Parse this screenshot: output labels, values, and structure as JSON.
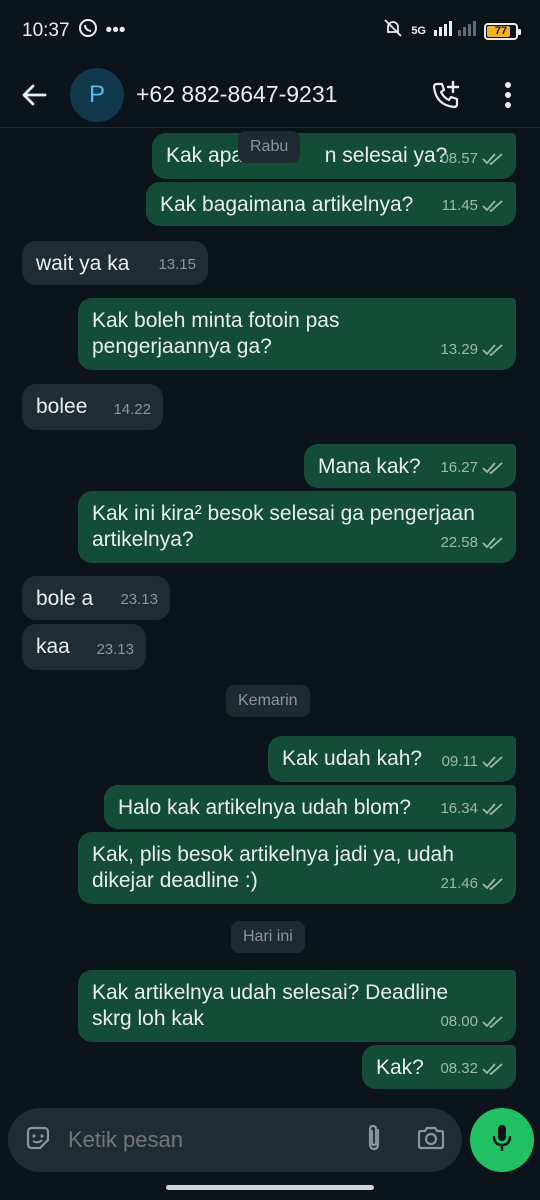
{
  "status_bar": {
    "time": "10:37",
    "network": "5G",
    "battery": "77"
  },
  "header": {
    "avatar_letter": "P",
    "contact": "+62 882-8647-9231"
  },
  "date_chips": {
    "rabu": "Rabu",
    "kemarin": "Kemarin",
    "hari_ini": "Hari ini"
  },
  "messages": [
    {
      "text": "Kak apa",
      "text2": "n selesai ya?",
      "time": "08.57"
    },
    {
      "text": "Kak bagaimana artikelnya?",
      "time": "11.45"
    },
    {
      "text": "wait ya ka",
      "time": "13.15"
    },
    {
      "line1": "Kak boleh minta fotoin pas",
      "line2": "pengerjaannya ga?",
      "time": "13.29"
    },
    {
      "text": "bolee",
      "time": "14.22"
    },
    {
      "text": "Mana kak?",
      "time": "16.27"
    },
    {
      "line1": "Kak ini kira² besok selesai ga pengerjaan",
      "line2": "artikelnya?",
      "time": "22.58"
    },
    {
      "text": "bole a",
      "time": "23.13"
    },
    {
      "text": "kaa",
      "time": "23.13"
    },
    {
      "text": "Kak udah kah?",
      "time": "09.11"
    },
    {
      "text": "Halo kak artikelnya udah blom?",
      "time": "16.34"
    },
    {
      "line1": "Kak, plis besok artikelnya jadi ya, udah",
      "line2": "dikejar deadline :)",
      "time": "21.46"
    },
    {
      "line1": "Kak artikelnya udah selesai? Deadline",
      "line2": "skrg loh kak",
      "time": "08.00"
    },
    {
      "text": "Kak?",
      "time": "08.32"
    }
  ],
  "composer": {
    "placeholder": "Ketik pesan"
  },
  "colors": {
    "outgoing": "#144d37",
    "incoming": "#202c33",
    "accent": "#21c063",
    "background": "#0b141a"
  },
  "icons": [
    "back-arrow-icon",
    "add-call-icon",
    "more-vert-icon",
    "sticker-icon",
    "attach-icon",
    "camera-icon",
    "mic-icon",
    "double-check-icon",
    "whatsapp-icon",
    "mute-icon",
    "signal-icon",
    "battery-icon"
  ]
}
